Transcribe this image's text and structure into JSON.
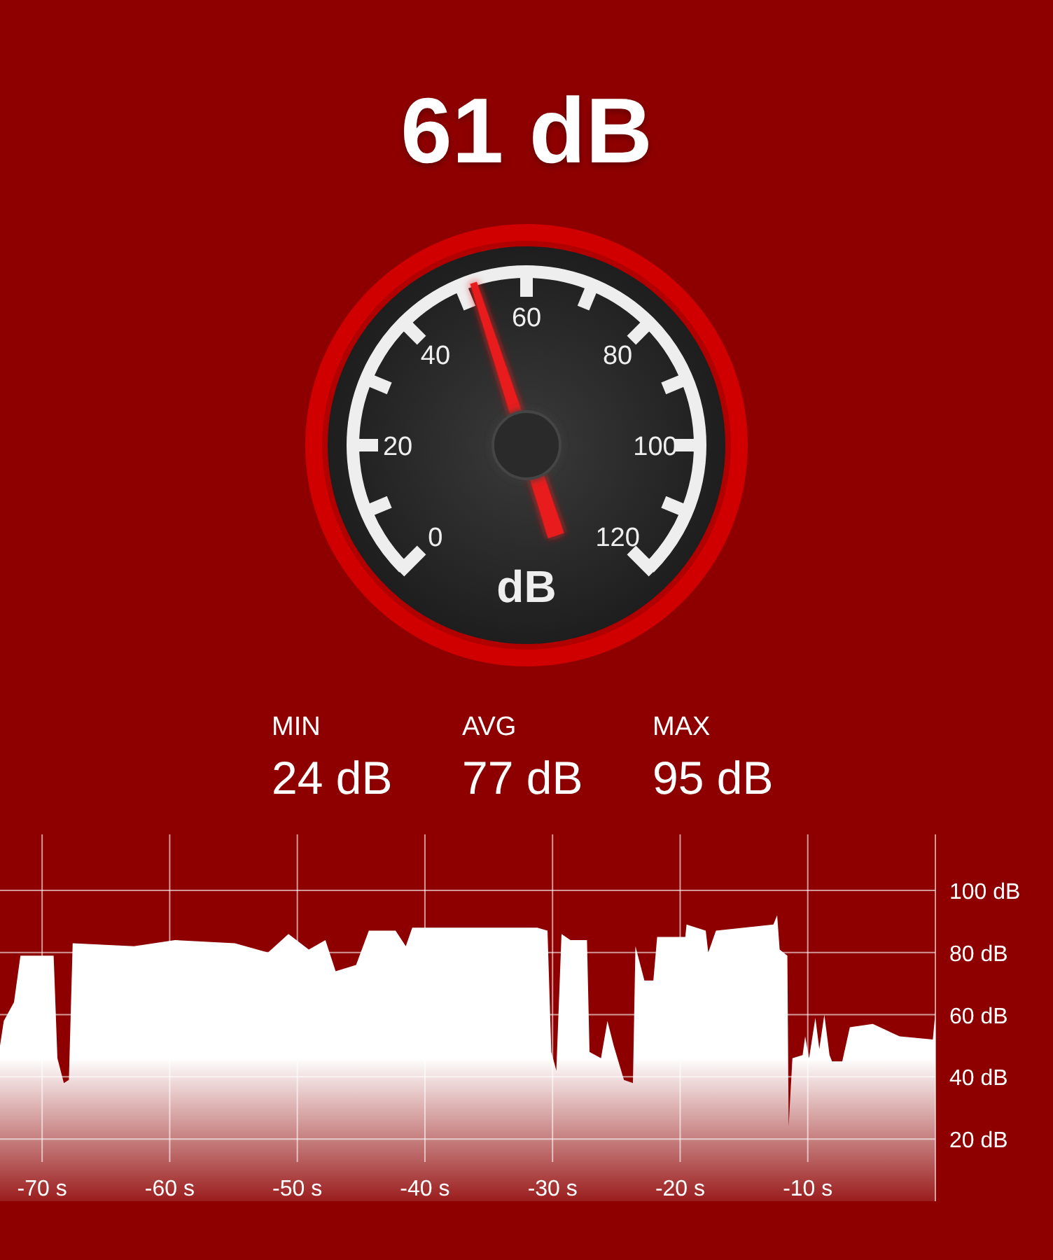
{
  "reading": "61 dB",
  "gauge": {
    "labels": [
      "0",
      "20",
      "40",
      "60",
      "80",
      "100",
      "120"
    ],
    "unit": "dB"
  },
  "stats": [
    {
      "label": "MIN",
      "value": "24 dB"
    },
    {
      "label": "AVG",
      "value": "77 dB"
    },
    {
      "label": "MAX",
      "value": "95 dB"
    }
  ],
  "history": {
    "chart_data": {
      "type": "area",
      "xlim": [
        -73.3,
        0
      ],
      "ylim": [
        0,
        118
      ],
      "grid": true,
      "xticks": [
        {
          "value": -70,
          "label": "-70 s"
        },
        {
          "value": -60,
          "label": "-60 s"
        },
        {
          "value": -50,
          "label": "-50 s"
        },
        {
          "value": -40,
          "label": "-40 s"
        },
        {
          "value": -30,
          "label": "-30 s"
        },
        {
          "value": -20,
          "label": "-20 s"
        },
        {
          "value": -10,
          "label": "-10 s"
        }
      ],
      "yticks": [
        {
          "value": 20,
          "label": "20 dB"
        },
        {
          "value": 40,
          "label": "40 dB"
        },
        {
          "value": 60,
          "label": "60 dB"
        },
        {
          "value": 80,
          "label": "80 dB"
        },
        {
          "value": 100,
          "label": "100 dB"
        }
      ],
      "x": [
        -73.3,
        -73.0,
        -72.2,
        -71.7,
        -69.1,
        -68.8,
        -68.3,
        -67.9,
        -67.6,
        -62.8,
        -59.6,
        -54.9,
        -52.3,
        -50.7,
        -49.1,
        -47.8,
        -47.0,
        -45.4,
        -44.4,
        -42.3,
        -41.5,
        -41.0,
        -31.2,
        -30.4,
        -30.1,
        -29.7,
        -29.3,
        -28.6,
        -27.9,
        -27.3,
        -27.1,
        -26.2,
        -25.7,
        -25.2,
        -24.4,
        -23.7,
        -23.5,
        -22.8,
        -22.1,
        -21.8,
        -19.6,
        -19.5,
        -18.0,
        -17.8,
        -17.2,
        -12.7,
        -12.4,
        -12.2,
        -11.6,
        -11.5,
        -11.2,
        -10.4,
        -10.2,
        -9.9,
        -9.4,
        -9.1,
        -8.7,
        -8.3,
        -8.1,
        -7.3,
        -6.7,
        -4.9,
        -2.8,
        -0.2,
        0
      ],
      "series": [
        {
          "color": "#ffffff",
          "values": [
            50,
            58,
            64,
            79,
            79,
            46,
            38,
            39,
            83,
            82,
            84,
            83,
            80,
            86,
            81,
            84,
            74,
            76,
            87,
            87,
            82,
            88,
            88,
            87,
            48,
            42,
            86,
            84,
            84,
            84,
            48,
            46,
            58,
            50,
            39,
            38,
            82,
            71,
            71,
            85,
            85,
            89,
            87,
            80,
            87,
            89,
            92,
            81,
            79,
            24,
            46,
            47,
            53,
            46,
            59,
            49,
            60,
            47,
            45,
            45,
            56,
            57,
            53,
            52,
            61
          ]
        }
      ]
    }
  }
}
